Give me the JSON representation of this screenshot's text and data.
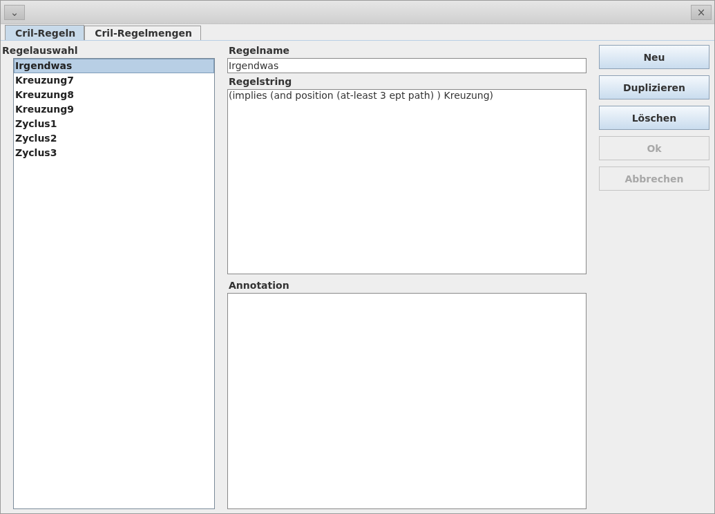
{
  "window": {
    "menu_glyph": "⌄",
    "close_glyph": "×"
  },
  "tabs": [
    {
      "label": "Cril-Regeln",
      "selected": true
    },
    {
      "label": "Cril-Regelmengen",
      "selected": false
    }
  ],
  "rule_list": {
    "label": "Regelauswahl",
    "items": [
      {
        "label": "Irgendwas",
        "selected": true
      },
      {
        "label": "Kreuzung7",
        "selected": false
      },
      {
        "label": "Kreuzung8",
        "selected": false
      },
      {
        "label": "Kreuzung9",
        "selected": false
      },
      {
        "label": "Zyclus1",
        "selected": false
      },
      {
        "label": "Zyclus2",
        "selected": false
      },
      {
        "label": "Zyclus3",
        "selected": false
      }
    ]
  },
  "rule_name": {
    "label": "Regelname",
    "value": "Irgendwas"
  },
  "rule_string": {
    "label": "Regelstring",
    "value": "(implies (and position (at-least 3 ept path) ) Kreuzung)"
  },
  "annotation": {
    "label": "Annotation"
  },
  "buttons": [
    {
      "label": "Neu",
      "disabled": false
    },
    {
      "label": "Duplizieren",
      "disabled": false
    },
    {
      "label": "Löschen",
      "disabled": false
    },
    {
      "label": "Ok",
      "disabled": true
    },
    {
      "label": "Abbrechen",
      "disabled": true
    }
  ]
}
